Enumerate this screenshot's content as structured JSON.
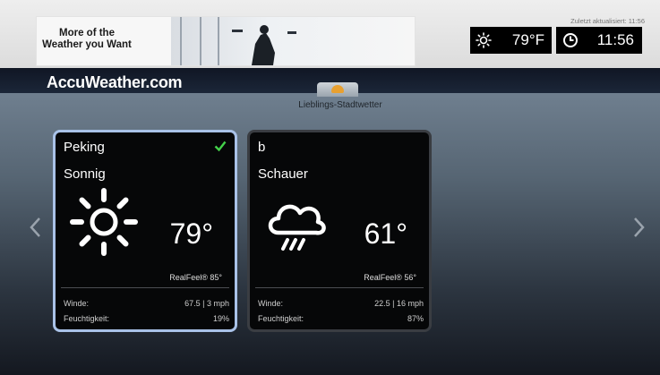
{
  "ad": {
    "headline": "More of the\nWeather you Want"
  },
  "header": {
    "updated_label": "Zuletzt aktualisiert: 11:56",
    "current_temp": "79°F",
    "current_time": "11:56"
  },
  "brand": {
    "name": "AccuWeather.com"
  },
  "section": {
    "title": "Lieblings-Stadtwetter"
  },
  "cards": [
    {
      "city": "Peking",
      "condition": "Sonnig",
      "temp": "79°",
      "realfeel": "RealFeel® 85°",
      "wind_label": "Winde:",
      "wind_value": "67.5 | 3 mph",
      "humidity_label": "Feuchtigkeit:",
      "humidity_value": "19%",
      "selected": true,
      "icon": "sun-icon"
    },
    {
      "city": "b",
      "condition": "Schauer",
      "temp": "61°",
      "realfeel": "RealFeel® 56°",
      "wind_label": "Winde:",
      "wind_value": "22.5 | 16 mph",
      "humidity_label": "Feuchtigkeit:",
      "humidity_value": "87%",
      "selected": false,
      "icon": "rain-cloud-icon"
    }
  ],
  "colors": {
    "selected_border": "#a9c2e8",
    "check": "#43d14a",
    "accent_tab": "#e8a030"
  }
}
